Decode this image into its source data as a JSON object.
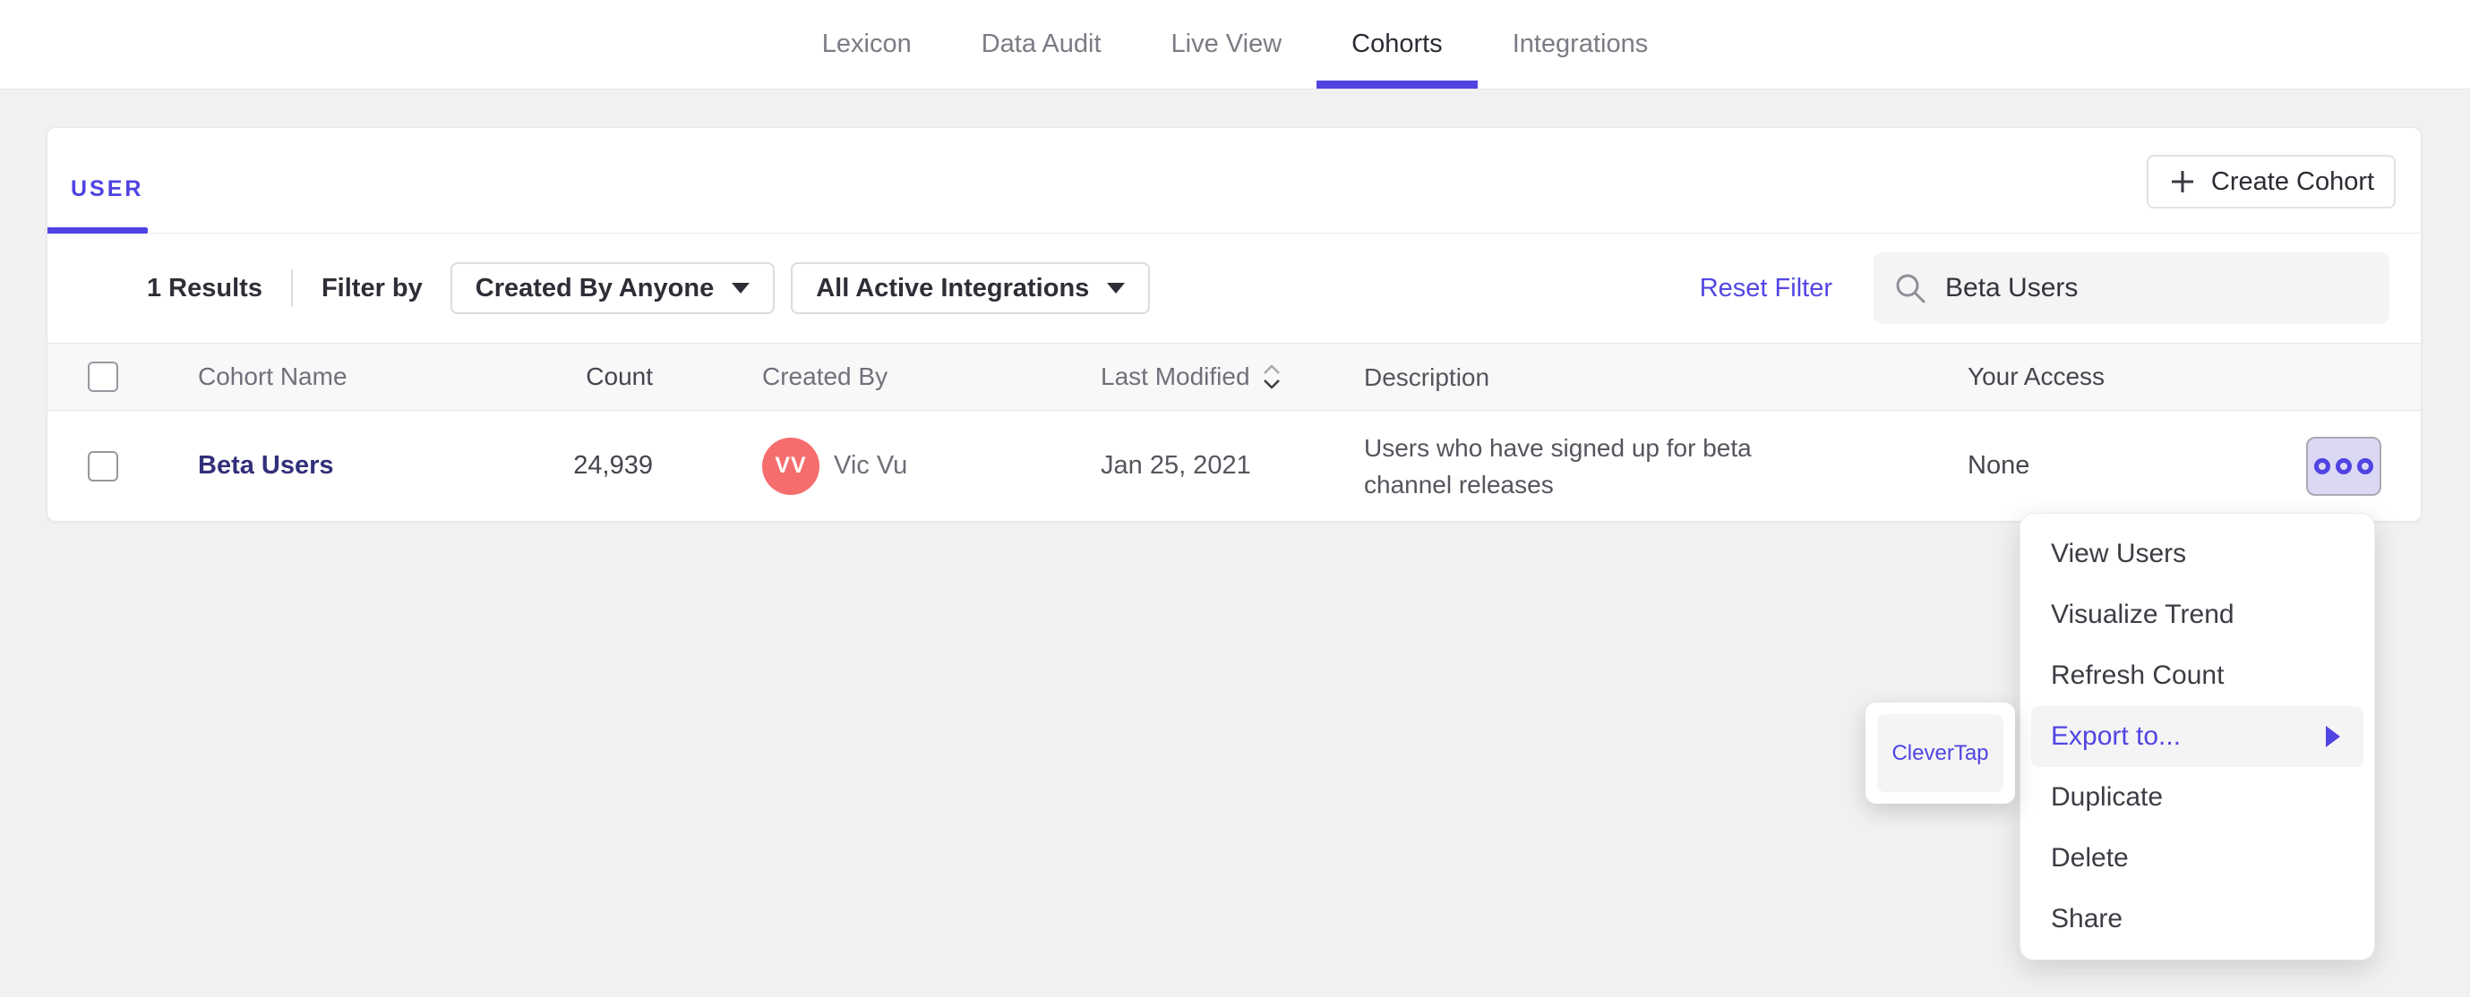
{
  "colors": {
    "accent": "#4f43e2",
    "link": "#5246e4",
    "cohort_link": "#32307a",
    "avatar_bg": "#f56d6d",
    "dots_button_bg": "#dbd8f4",
    "page_bg": "#f1f1f2"
  },
  "nav": {
    "tabs": [
      {
        "label": "Lexicon",
        "active": false
      },
      {
        "label": "Data Audit",
        "active": false
      },
      {
        "label": "Live View",
        "active": false
      },
      {
        "label": "Cohorts",
        "active": true
      },
      {
        "label": "Integrations",
        "active": false
      }
    ]
  },
  "card": {
    "tab_label": "USER",
    "create_button": "Create Cohort",
    "filters": {
      "results": "1 Results",
      "filter_by": "Filter by",
      "created_by_dropdown": "Created By Anyone",
      "integrations_dropdown": "All Active Integrations",
      "reset": "Reset Filter",
      "search_value": "Beta Users"
    },
    "table": {
      "headers": [
        "Cohort Name",
        "Count",
        "Created By",
        "Last Modified",
        "Description",
        "Your Access"
      ],
      "rows": [
        {
          "name": "Beta Users",
          "count": "24,939",
          "created_by_initials": "VV",
          "created_by": "Vic Vu",
          "last_modified": "Jan 25, 2021",
          "description": "Users who have signed up for beta channel releases",
          "access": "None"
        }
      ]
    }
  },
  "menu": {
    "items": [
      "View Users",
      "Visualize Trend",
      "Refresh Count",
      "Export to...",
      "Duplicate",
      "Delete",
      "Share"
    ],
    "highlighted_item": "Export to..."
  },
  "submenu": {
    "items": [
      "CleverTap"
    ]
  },
  "icons": {
    "plus": "plus-icon",
    "search": "search-icon",
    "sort": "sort-icon",
    "caret": "chevron-down-icon",
    "dots": "more-options-icon",
    "submenu_arrow": "chevron-right-icon"
  }
}
